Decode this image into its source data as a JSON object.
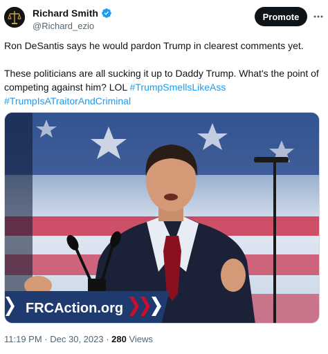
{
  "author": {
    "display_name": "Richard Smith",
    "handle": "@Richard_ezio",
    "avatar_icon": "scales-of-justice-icon",
    "verified_icon": "verified-badge-icon",
    "verified_color": "#1d9bf0"
  },
  "actions": {
    "promote_label": "Promote",
    "more_icon": "more-options-icon"
  },
  "tweet": {
    "line1": "Ron DeSantis says he would pardon Trump in clearest comments yet.",
    "line2": "These politicians are all sucking it up to Daddy Trump. What's the point of",
    "line3_text": "competing against him? LOL ",
    "hashtag1": "#TrumpSmellsLikeAss",
    "hashtag2": "#TrumpIsATraitorAndCriminal",
    "hashtag_color": "#1d9bf0"
  },
  "media": {
    "podium_sign": "FRCAction.org",
    "brand_color": "#1e3a6e",
    "accent_color": "#c8102e"
  },
  "meta": {
    "time": "11:19 PM",
    "separator1": " · ",
    "date": "Dec 30, 2023",
    "separator2": " · ",
    "views_count": "280",
    "views_label": " Views"
  }
}
